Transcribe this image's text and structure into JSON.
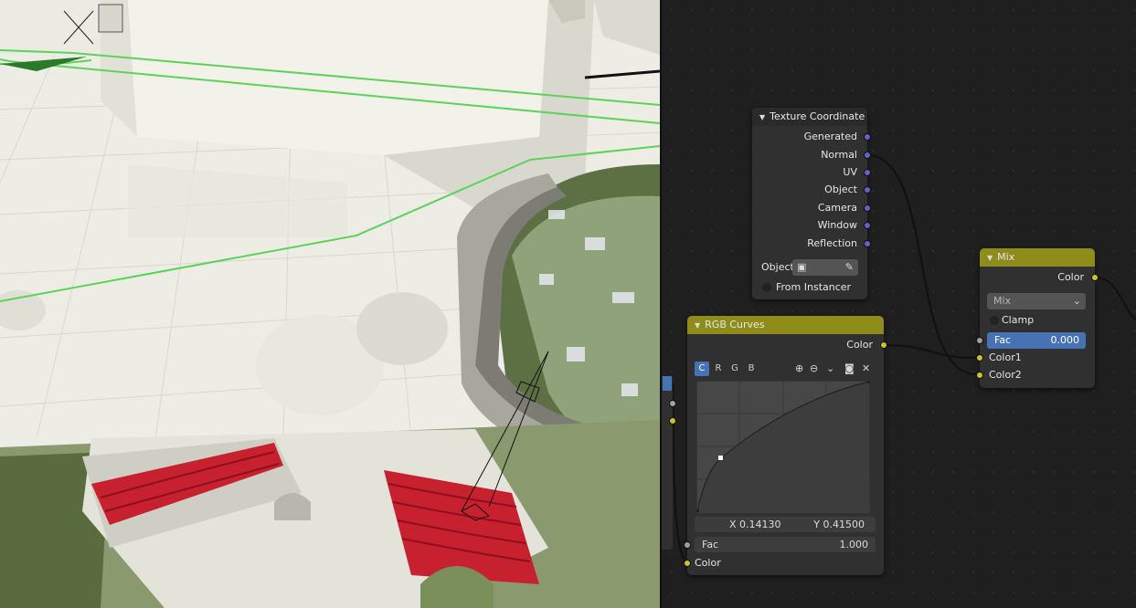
{
  "nodes": {
    "texture_coordinate": {
      "title": "Texture Coordinate",
      "outputs": [
        "Generated",
        "Normal",
        "UV",
        "Object",
        "Camera",
        "Window",
        "Reflection"
      ],
      "object_label": "Object:",
      "from_instancer_label": "From Instancer"
    },
    "rgb_curves": {
      "title": "RGB Curves",
      "output_label": "Color",
      "channels": [
        "C",
        "R",
        "G",
        "B"
      ],
      "active_channel": "C",
      "point_x": "X 0.14130",
      "point_y": "Y 0.41500",
      "fac_label": "Fac",
      "fac_value": "1.000",
      "input_label": "Color"
    },
    "mix": {
      "title": "Mix",
      "output_label": "Color",
      "blend_mode": "Mix",
      "clamp_label": "Clamp",
      "fac_label": "Fac",
      "fac_value": "0.000",
      "color1_label": "Color1",
      "color2_label": "Color2"
    }
  },
  "colors": {
    "header_olive": "#8e8d1c",
    "socket_purple": "#6363c7",
    "socket_yellow": "#c7c729",
    "socket_gray": "#a1a1a1",
    "accent_blue": "#4772b3"
  },
  "icons": [
    "triangle-down-icon",
    "eyedropper-icon",
    "object-square-icon",
    "zoom-in-icon",
    "zoom-out-icon",
    "chevron-down-icon",
    "dot-icon",
    "close-icon"
  ]
}
